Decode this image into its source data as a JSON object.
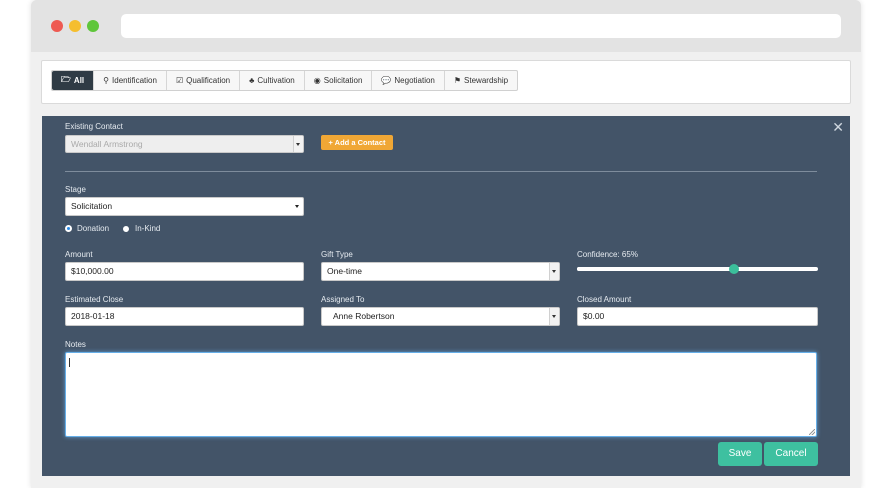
{
  "tabs": [
    {
      "icon": "folder-open-icon",
      "glyph": "🗁",
      "label": "All",
      "active": true
    },
    {
      "icon": "search-icon",
      "glyph": "⚲",
      "label": "Identification"
    },
    {
      "icon": "check-square-icon",
      "glyph": "☑",
      "label": "Qualification"
    },
    {
      "icon": "tree-icon",
      "glyph": "♣",
      "label": "Cultivation"
    },
    {
      "icon": "bullseye-icon",
      "glyph": "◉",
      "label": "Solicitation"
    },
    {
      "icon": "comments-icon",
      "glyph": "💬",
      "label": "Negotiation"
    },
    {
      "icon": "flag-icon",
      "glyph": "⚑",
      "label": "Stewardship"
    }
  ],
  "form": {
    "close_glyph": "✕",
    "existing_contact": {
      "label": "Existing Contact",
      "value": "Wendall Armstrong"
    },
    "add_contact_label": "+ Add a Contact",
    "stage": {
      "label": "Stage",
      "value": "Solicitation"
    },
    "radios": [
      {
        "label": "Donation",
        "checked": true
      },
      {
        "label": "In-Kind",
        "checked": false
      }
    ],
    "amount": {
      "label": "Amount",
      "value": "$10,000.00"
    },
    "gift_type": {
      "label": "Gift Type",
      "value": "One-time"
    },
    "confidence": {
      "label": "Confidence: 65%",
      "value": 0.65
    },
    "estimated_close": {
      "label": "Estimated Close",
      "value": "2018-01-18"
    },
    "assigned_to": {
      "label": "Assigned To",
      "value": "Anne Robertson"
    },
    "closed_amount": {
      "label": "Closed Amount",
      "value": "$0.00"
    },
    "notes": {
      "label": "Notes",
      "value": ""
    },
    "save_label": "Save",
    "cancel_label": "Cancel"
  },
  "colors": {
    "panel": "#435468",
    "accent_orange": "#f0a735",
    "accent_green": "#3ec0a0",
    "tab_active": "#2f3b45"
  }
}
